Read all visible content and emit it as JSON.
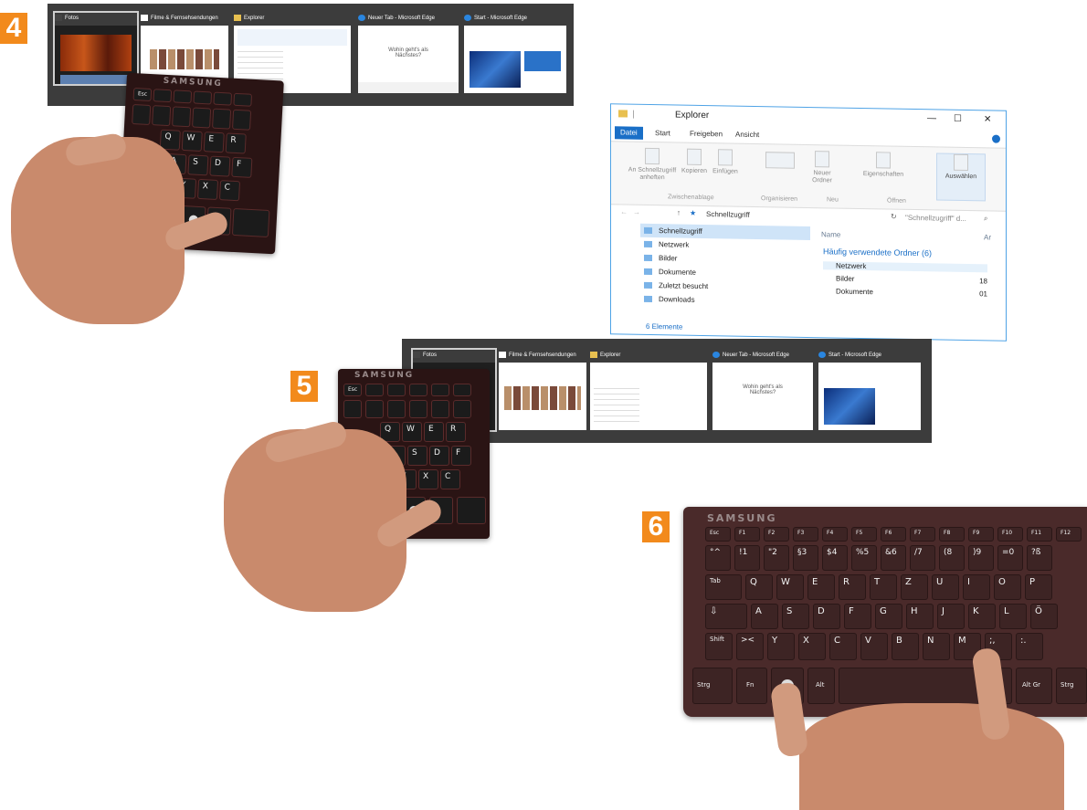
{
  "steps": {
    "s4": "4",
    "s5": "5",
    "s6": "6"
  },
  "switcher": {
    "tabs": [
      {
        "label": "Fotos"
      },
      {
        "label": "Filme & Fernsehsendungen"
      },
      {
        "label": "Explorer"
      },
      {
        "label": "Neuer Tab - Microsoft Edge"
      },
      {
        "label": "Start - Microsoft Edge"
      }
    ],
    "edge_prompt": "Wohin geht's als Nächstes?"
  },
  "keyboard": {
    "brand": "SAMSUNG"
  },
  "explorer": {
    "title": "Explorer",
    "window_controls": {
      "minimize": "—",
      "maximize": "☐",
      "close": "✕"
    },
    "tabs": [
      "Datei",
      "Start",
      "Freigeben",
      "Ansicht"
    ],
    "ribbon": {
      "pin": "An Schnellzugriff anheften",
      "copy": "Kopieren",
      "paste": "Einfügen",
      "group_clipboard": "Zwischenablage",
      "group_organize": "Organisieren",
      "new_folder": "Neuer Ordner",
      "group_new": "Neu",
      "properties": "Eigenschaften",
      "group_open": "Öffnen",
      "select": "Auswählen"
    },
    "address": "Schnellzugriff",
    "search_placeholder": "\"Schnellzugriff\" d...",
    "nav_items": [
      "Schnellzugriff",
      "Netzwerk",
      "Bilder",
      "Dokumente",
      "Zuletzt besucht",
      "Downloads"
    ],
    "status": "6 Elemente",
    "column_name": "Name",
    "column_extra": "Ar",
    "group_header": "Häufig verwendete Ordner (6)",
    "content_items": [
      {
        "name": "Netzwerk",
        "extra": ""
      },
      {
        "name": "Bilder",
        "extra": "18"
      },
      {
        "name": "Dokumente",
        "extra": "01"
      }
    ]
  },
  "big_keyboard": {
    "brand": "SAMSUNG",
    "fn_row": [
      "Esc",
      "F1",
      "F2",
      "F3",
      "F4",
      "F5",
      "F6",
      "F7",
      "F8",
      "F9",
      "F10",
      "F11",
      "F12"
    ],
    "num_row": [
      "°^",
      "!1",
      "\"2",
      "§3",
      "$4",
      "%5",
      "&6",
      "/7",
      "(8",
      ")9",
      "=0",
      "?ß"
    ],
    "row_q": [
      "Tab",
      "Q",
      "W",
      "E",
      "R",
      "T",
      "Z",
      "U",
      "I",
      "O",
      "P"
    ],
    "row_a": [
      "⇩",
      "A",
      "S",
      "D",
      "F",
      "G",
      "H",
      "J",
      "K",
      "L",
      "Ö"
    ],
    "row_y": [
      "Shift",
      "><",
      "Y",
      "X",
      "C",
      "V",
      "B",
      "N",
      "M",
      ";,",
      ":."
    ],
    "bottom": {
      "ctrl": "Strg",
      "fn": "Fn",
      "alt": "Alt",
      "altgr": "Alt Gr",
      "ctrl2": "Strg"
    }
  }
}
